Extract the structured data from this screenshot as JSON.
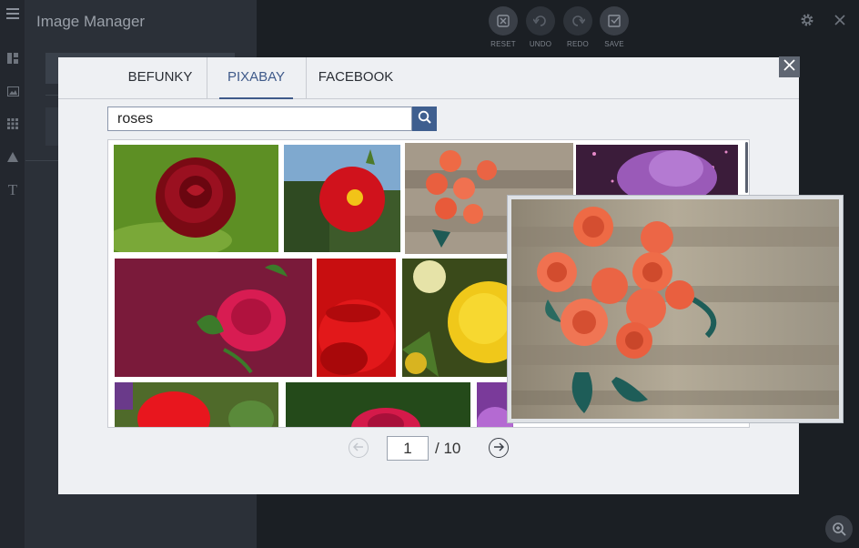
{
  "app": {
    "panel_title": "Image Manager"
  },
  "toolbar": {
    "reset_label": "RESET",
    "undo_label": "UNDO",
    "redo_label": "REDO",
    "save_label": "SAVE"
  },
  "modal": {
    "tabs": [
      {
        "label": "BEFUNKY",
        "active": false
      },
      {
        "label": "PIXABAY",
        "active": true
      },
      {
        "label": "FACEBOOK",
        "active": false
      }
    ],
    "search": {
      "value": "roses"
    },
    "pagination": {
      "current_page": "1",
      "total": "/ 10"
    }
  },
  "colors": {
    "accent": "#3f5a8a",
    "modal_bg": "#eef0f3",
    "canvas_bg": "#1b1f24"
  },
  "icons": {
    "rail": [
      "menu-icon",
      "layout-icon",
      "image-icon",
      "grid-icon",
      "shapes-icon",
      "text-icon"
    ],
    "toolbar": [
      "reset-icon",
      "undo-icon",
      "redo-icon",
      "save-icon"
    ],
    "corner": [
      "gear-icon",
      "close-icon"
    ],
    "modal": [
      "search-icon",
      "close-icon",
      "arrow-left-icon",
      "arrow-right-icon",
      "zoom-in-icon"
    ]
  }
}
